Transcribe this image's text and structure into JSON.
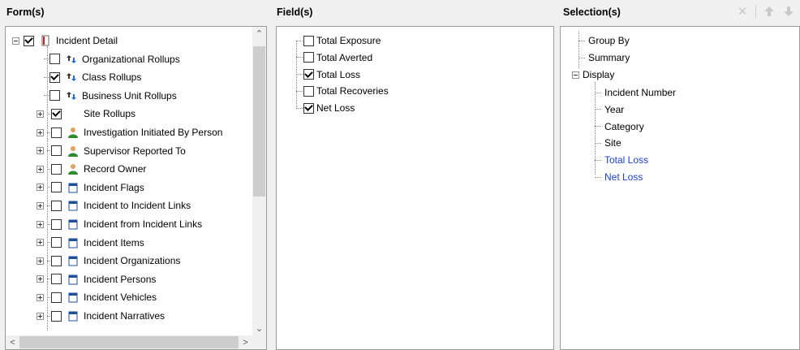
{
  "panes": {
    "forms_header": "Form(s)",
    "fields_header": "Field(s)",
    "selections_header": "Selection(s)"
  },
  "forms": [
    {
      "label": "Incident Detail",
      "checked": true,
      "icon": "form-red-icon",
      "expander": "minus"
    },
    {
      "label": "Organizational Rollups",
      "checked": false,
      "icon": "rollup-icon",
      "expander": null
    },
    {
      "label": "Class Rollups",
      "checked": true,
      "icon": "rollup-icon",
      "expander": null
    },
    {
      "label": "Business Unit Rollups",
      "checked": false,
      "icon": "rollup-icon",
      "expander": null
    },
    {
      "label": "Site Rollups",
      "checked": true,
      "icon": "none",
      "expander": "plus"
    },
    {
      "label": "Investigation Initiated By Person",
      "checked": false,
      "icon": "person-icon",
      "expander": "plus"
    },
    {
      "label": "Supervisor Reported To",
      "checked": false,
      "icon": "person-icon",
      "expander": "plus"
    },
    {
      "label": "Record Owner",
      "checked": false,
      "icon": "person-icon",
      "expander": "plus"
    },
    {
      "label": "Incident Flags",
      "checked": false,
      "icon": "calendar-icon",
      "expander": "plus"
    },
    {
      "label": "Incident to Incident Links",
      "checked": false,
      "icon": "calendar-icon",
      "expander": "plus"
    },
    {
      "label": "Incident from Incident Links",
      "checked": false,
      "icon": "calendar-icon",
      "expander": "plus"
    },
    {
      "label": "Incident Items",
      "checked": false,
      "icon": "calendar-icon",
      "expander": "plus"
    },
    {
      "label": "Incident Organizations",
      "checked": false,
      "icon": "calendar-icon",
      "expander": "plus"
    },
    {
      "label": "Incident Persons",
      "checked": false,
      "icon": "calendar-icon",
      "expander": "plus"
    },
    {
      "label": "Incident Vehicles",
      "checked": false,
      "icon": "calendar-icon",
      "expander": "plus"
    },
    {
      "label": "Incident Narratives",
      "checked": false,
      "icon": "calendar-icon",
      "expander": "plus"
    }
  ],
  "fields": [
    {
      "label": "Total Exposure",
      "checked": false
    },
    {
      "label": "Total Averted",
      "checked": false
    },
    {
      "label": "Total Loss",
      "checked": true
    },
    {
      "label": "Total Recoveries",
      "checked": false
    },
    {
      "label": "Net Loss",
      "checked": true
    }
  ],
  "selections": {
    "group_by": "Group By",
    "summary": "Summary",
    "display": "Display",
    "display_items": [
      {
        "label": "Incident Number",
        "highlight": false
      },
      {
        "label": "Year",
        "highlight": false
      },
      {
        "label": "Category",
        "highlight": false
      },
      {
        "label": "Site",
        "highlight": false
      },
      {
        "label": "Total Loss",
        "highlight": true
      },
      {
        "label": "Net Loss",
        "highlight": true
      }
    ]
  },
  "toolbar": {
    "icons": [
      "delete-icon",
      "move-up-icon",
      "move-down-icon"
    ]
  },
  "colors": {
    "highlight_text": "#1c3fd4",
    "pane_bg": "#f0f0f0"
  }
}
